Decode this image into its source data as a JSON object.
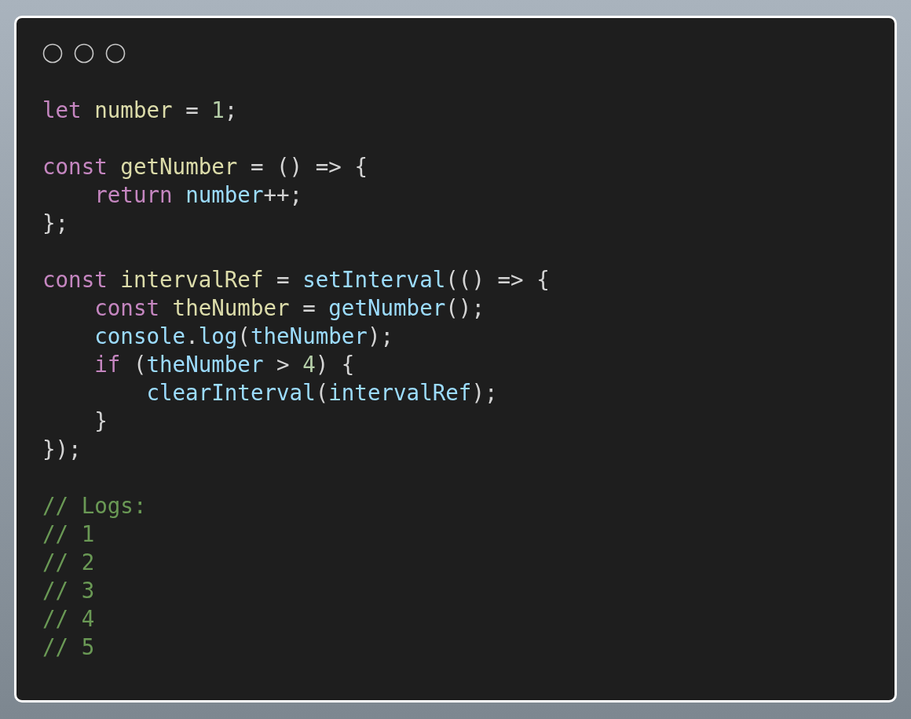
{
  "code": {
    "blocks": [
      [
        {
          "tokens": [
            {
              "text": "let",
              "kind": "keyword"
            },
            {
              "text": " number",
              "kind": "name"
            },
            {
              "text": " = ",
              "kind": "plain"
            },
            {
              "text": "1",
              "kind": "number"
            },
            {
              "text": ";",
              "kind": "plain"
            }
          ]
        }
      ],
      [
        {
          "tokens": [
            {
              "text": "const",
              "kind": "keyword"
            },
            {
              "text": " getNumber",
              "kind": "name"
            },
            {
              "text": " = () => {",
              "kind": "plain"
            }
          ]
        },
        {
          "tokens": [
            {
              "text": "    return",
              "kind": "keyword"
            },
            {
              "text": " number",
              "kind": "variable"
            },
            {
              "text": "++;",
              "kind": "plain"
            }
          ]
        },
        {
          "tokens": [
            {
              "text": "};",
              "kind": "plain"
            }
          ]
        }
      ],
      [
        {
          "tokens": [
            {
              "text": "const",
              "kind": "keyword"
            },
            {
              "text": " intervalRef",
              "kind": "name"
            },
            {
              "text": " = ",
              "kind": "plain"
            },
            {
              "text": "setInterval",
              "kind": "variable"
            },
            {
              "text": "(() => {",
              "kind": "plain"
            }
          ]
        },
        {
          "tokens": [
            {
              "text": "    const",
              "kind": "keyword"
            },
            {
              "text": " theNumber",
              "kind": "name"
            },
            {
              "text": " = ",
              "kind": "plain"
            },
            {
              "text": "getNumber",
              "kind": "variable"
            },
            {
              "text": "();",
              "kind": "plain"
            }
          ]
        },
        {
          "tokens": [
            {
              "text": "    console",
              "kind": "variable"
            },
            {
              "text": ".",
              "kind": "plain"
            },
            {
              "text": "log",
              "kind": "variable"
            },
            {
              "text": "(",
              "kind": "plain"
            },
            {
              "text": "theNumber",
              "kind": "variable"
            },
            {
              "text": ");",
              "kind": "plain"
            }
          ]
        },
        {
          "tokens": [
            {
              "text": "    if",
              "kind": "keyword"
            },
            {
              "text": " (",
              "kind": "plain"
            },
            {
              "text": "theNumber",
              "kind": "variable"
            },
            {
              "text": " > ",
              "kind": "plain"
            },
            {
              "text": "4",
              "kind": "number"
            },
            {
              "text": ") {",
              "kind": "plain"
            }
          ]
        },
        {
          "tokens": [
            {
              "text": "        clearInterval",
              "kind": "variable"
            },
            {
              "text": "(",
              "kind": "plain"
            },
            {
              "text": "intervalRef",
              "kind": "variable"
            },
            {
              "text": ");",
              "kind": "plain"
            }
          ]
        },
        {
          "tokens": [
            {
              "text": "    }",
              "kind": "plain"
            }
          ]
        },
        {
          "tokens": [
            {
              "text": "});",
              "kind": "plain"
            }
          ]
        }
      ],
      [
        {
          "tokens": [
            {
              "text": "// Logs:",
              "kind": "comment"
            }
          ]
        },
        {
          "tokens": [
            {
              "text": "// 1",
              "kind": "comment"
            }
          ]
        },
        {
          "tokens": [
            {
              "text": "// 2",
              "kind": "comment"
            }
          ]
        },
        {
          "tokens": [
            {
              "text": "// 3",
              "kind": "comment"
            }
          ]
        },
        {
          "tokens": [
            {
              "text": "// 4",
              "kind": "comment"
            }
          ]
        },
        {
          "tokens": [
            {
              "text": "// 5",
              "kind": "comment"
            }
          ]
        }
      ]
    ]
  }
}
